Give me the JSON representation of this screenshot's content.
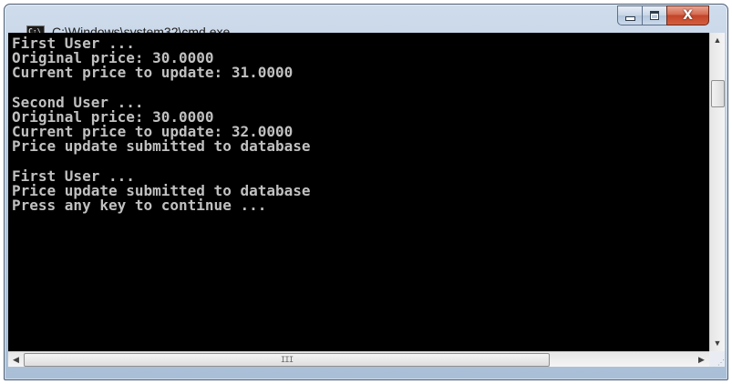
{
  "window": {
    "title": "C:\\Windows\\system32\\cmd.exe",
    "icon": "cmd-app-icon",
    "icon_text": "C:\\",
    "buttons": {
      "minimize_icon": "minimize-icon",
      "maximize_icon": "maximize-icon",
      "close_icon": "close-icon",
      "close_glyph": "X"
    }
  },
  "console": {
    "text": "First User ...\nOriginal price: 30.0000\nCurrent price to update: 31.0000\n\nSecond User ...\nOriginal price: 30.0000\nCurrent price to update: 32.0000\nPrice update submitted to database\n\nFirst User ...\nPrice update submitted to database\nPress any key to continue ...",
    "background": "#000000",
    "foreground": "#c0c0c0"
  },
  "scrollbars": {
    "vertical": {
      "up_arrow": "▲",
      "down_arrow": "▼"
    },
    "horizontal": {
      "left_arrow": "◀",
      "right_arrow": "▶",
      "grip": "III"
    }
  },
  "colors": {
    "frame": "#b7cadf",
    "close_button": "#c2452a"
  }
}
